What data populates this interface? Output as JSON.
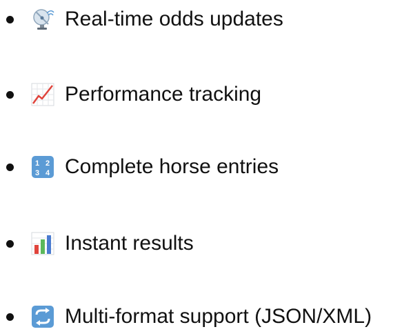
{
  "features": [
    {
      "icon": "satellite-antenna-icon",
      "label": "Real-time odds updates"
    },
    {
      "icon": "chart-increasing-icon",
      "label": "Performance tracking"
    },
    {
      "icon": "input-numbers-icon",
      "label": "Complete horse entries"
    },
    {
      "icon": "bar-chart-icon",
      "label": "Instant results"
    },
    {
      "icon": "counterclockwise-arrows-icon",
      "label": "Multi-format support (JSON/XML)"
    }
  ],
  "colors": {
    "text": "#111111",
    "background": "#ffffff",
    "icon_blue": "#5b9bd5",
    "chart_red": "#e0443c"
  }
}
